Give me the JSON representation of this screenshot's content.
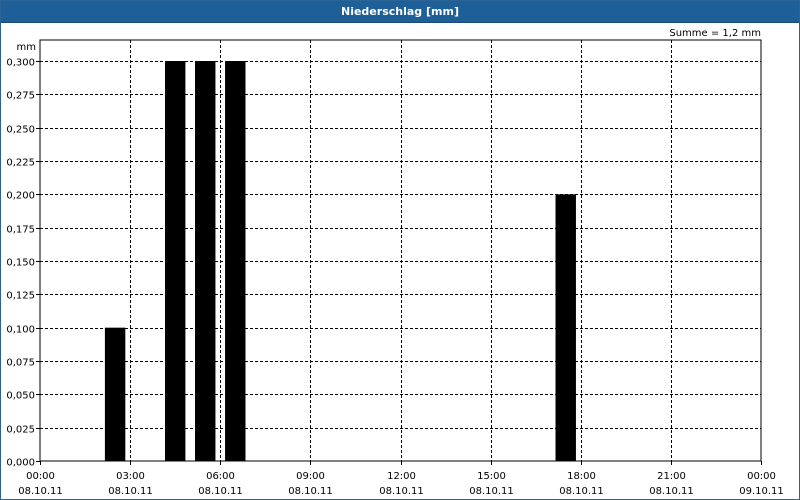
{
  "window": {
    "title": "Niederschlag [mm]"
  },
  "chart_data": {
    "type": "bar",
    "title": "Niederschlag [mm]",
    "ylabel": "mm",
    "annotation": "Summe = 1,2 mm",
    "ylim": [
      0,
      0.3
    ],
    "yticks": [
      "0,000",
      "0,025",
      "0,050",
      "0,075",
      "0,100",
      "0,125",
      "0,150",
      "0,175",
      "0,200",
      "0,225",
      "0,250",
      "0,275",
      "0,300"
    ],
    "xlim_hours": [
      0,
      24
    ],
    "xticks": [
      {
        "time": "00:00",
        "date": "08.10.11"
      },
      {
        "time": "03:00",
        "date": "08.10.11"
      },
      {
        "time": "06:00",
        "date": "08.10.11"
      },
      {
        "time": "09:00",
        "date": "08.10.11"
      },
      {
        "time": "12:00",
        "date": "08.10.11"
      },
      {
        "time": "15:00",
        "date": "08.10.11"
      },
      {
        "time": "18:00",
        "date": "08.10.11"
      },
      {
        "time": "21:00",
        "date": "08.10.11"
      },
      {
        "time": "00:00",
        "date": "09.10.11"
      }
    ],
    "bars": [
      {
        "start": "02:00",
        "end": "03:00",
        "value": 0.1
      },
      {
        "start": "04:00",
        "end": "05:00",
        "value": 0.3
      },
      {
        "start": "05:00",
        "end": "06:00",
        "value": 0.3
      },
      {
        "start": "06:00",
        "end": "07:00",
        "value": 0.3
      },
      {
        "start": "17:00",
        "end": "18:00",
        "value": 0.2
      }
    ],
    "bar_color": "#000000",
    "grid": true
  }
}
